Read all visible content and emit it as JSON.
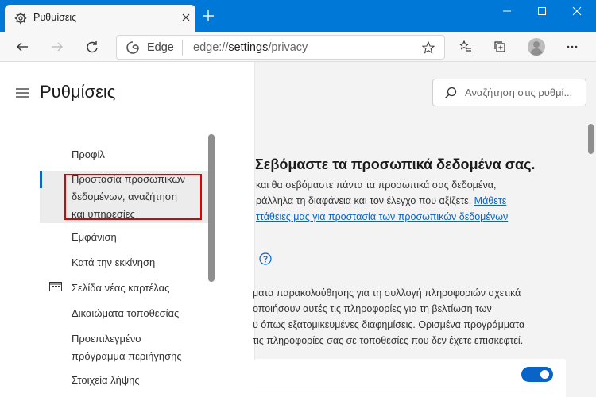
{
  "browser": {
    "tab_title": "Ρυθμίσεις",
    "address_brand": "Edge",
    "address_scheme": "edge://",
    "address_host": "settings",
    "address_path": "/privacy",
    "accent_color": "#0078d7"
  },
  "sidebar": {
    "title": "Ρυθμίσεις",
    "items": [
      {
        "lines": [
          "Προφίλ"
        ]
      },
      {
        "lines": [
          "Προστασία προσωπικών",
          "δεδομένων, αναζήτηση",
          "και υπηρεσίες"
        ],
        "selected": true
      },
      {
        "lines": [
          "Εμφάνιση"
        ]
      },
      {
        "lines": [
          "Κατά την εκκίνηση"
        ]
      },
      {
        "lines": [
          "Σελίδα νέας καρτέλας"
        ]
      },
      {
        "lines": [
          "Δικαιώματα τοποθεσίας"
        ]
      },
      {
        "lines": [
          "Προεπιλεγμένο",
          "πρόγραμμα περιήγησης"
        ]
      },
      {
        "lines": [
          "Στοιχεία λήψης"
        ]
      }
    ],
    "highlight_color": "#e00000"
  },
  "search": {
    "placeholder": "Αναζήτηση στις ρυθμί..."
  },
  "content": {
    "heading": "Σεβόμαστε τα προσωπικά δεδομένα σας.",
    "intro_line1": "και θα σεβόμαστε πάντα τα προσωπικά σας δεδομένα,",
    "intro_line2": "ράλληλα τη διαφάνεια και τον έλεγχο που αξίζετε.",
    "intro_link_a": "Μάθετε",
    "intro_link_b": "ττάθειες μας για προστασία των προσωπικών δεδομένων",
    "tracking_line1": "ματα παρακολούθησης για τη συλλογή πληροφοριών σχετικά",
    "tracking_line2": "οποιήσουν αυτές τις πληροφορίες για τη βελτίωση των",
    "tracking_line3": "υ όπως εξατομικευμένες διαφημίσεις. Ορισμένα προγράμματα",
    "tracking_line4": "τις πληροφορίες σας σε τοποθεσίες που δεν έχετε επισκεφτεί.",
    "toggle_on": true
  }
}
